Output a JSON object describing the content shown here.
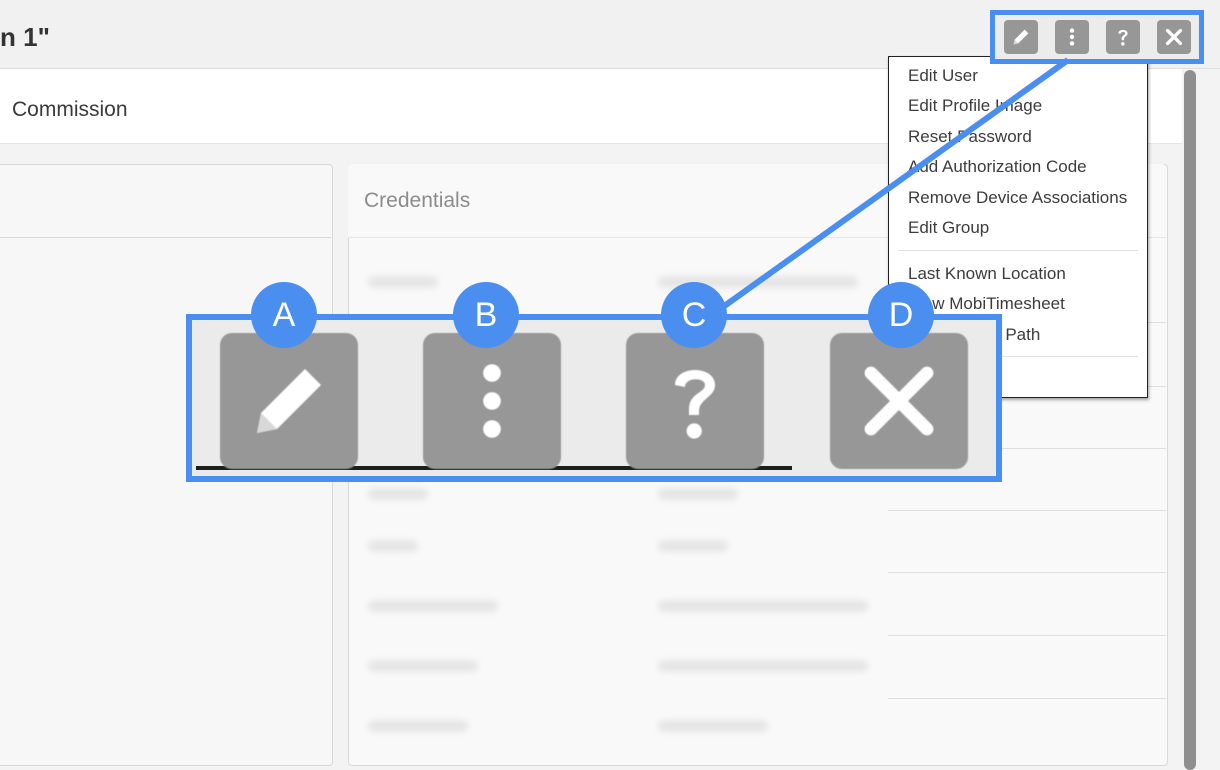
{
  "header": {
    "title": "n 1\""
  },
  "subbar": {
    "label": "Commission"
  },
  "credentials": {
    "title": "Credentials"
  },
  "menu": {
    "items": [
      "Edit User",
      "Edit Profile Image",
      "Reset Password",
      "Add Authorization Code",
      "Remove Device Associations",
      "Edit Group",
      "Last Known Location",
      "View MobiTimesheet",
      "Breadcrumb Path"
    ]
  },
  "toolbar": {
    "icons": [
      "pencil-icon",
      "more-vertical-icon",
      "help-icon",
      "close-icon"
    ]
  },
  "callouts": {
    "a": "A",
    "b": "B",
    "c": "C",
    "d": "D"
  },
  "colors": {
    "highlight": "#4a8ef0",
    "button": "#979797"
  }
}
